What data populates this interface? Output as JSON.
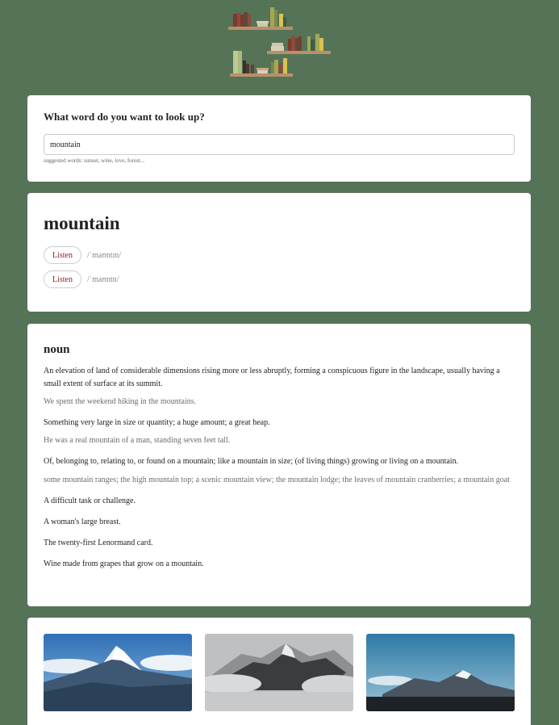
{
  "logo": {
    "icon": "bookshelf-icon"
  },
  "search": {
    "question": "What word do you want to look up?",
    "value": "mountain",
    "suggested": "suggested words: sunset, wine, love, forest..."
  },
  "word": {
    "title": "mountain",
    "pronunciations": [
      {
        "button": "Listen",
        "phonetic": "/ˈmaʊntɪn/"
      },
      {
        "button": "Listen",
        "phonetic": "/ˈmaʊntn/"
      }
    ]
  },
  "meaning": {
    "part_of_speech": "noun",
    "definitions": [
      {
        "text": "An elevation of land of considerable dimensions rising more or less abruptly, forming a conspicuous figure in the landscape, usually having a small extent of surface at its summit.",
        "example": "We spent the weekend hiking in the mountains."
      },
      {
        "text": "Something very large in size or quantity; a huge amount; a great heap.",
        "example": "He was a real mountain of a man, standing seven feet tall."
      },
      {
        "text": "Of, belonging to, relating to, or found on a mountain; like a mountain in size; (of living things) growing or living on a mountain.",
        "example": "some mountain ranges; the high mountain top; a scenic mountain view; the mountain lodge; the leaves of mountain cranberries; a mountain goat"
      },
      {
        "text": "A difficult task or challenge."
      },
      {
        "text": "A woman's large breast."
      },
      {
        "text": "The twenty-first Lenormand card."
      },
      {
        "text": "Wine made from grapes that grow on a mountain."
      }
    ]
  },
  "colors": {
    "background": "#557357",
    "listen_text": "#8b1c1c"
  }
}
